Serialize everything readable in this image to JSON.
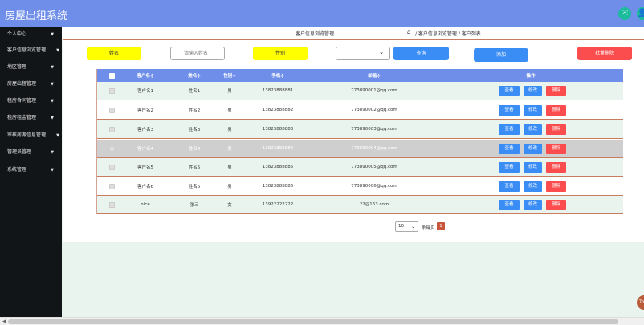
{
  "app": {
    "title": "房屋出租系统"
  },
  "top_icons": [
    {
      "icon": "expand-icon",
      "glyph": "⤧"
    },
    {
      "icon": "user-icon",
      "glyph": "👤"
    }
  ],
  "sidebar": {
    "items": [
      {
        "label": "个人中心"
      },
      {
        "label": "客户信息浏览管理"
      },
      {
        "label": "地区管理"
      },
      {
        "label": "房屋出租管理"
      },
      {
        "label": "租房合同管理"
      },
      {
        "label": "租房租金管理"
      },
      {
        "label": "审核房源信息管理"
      },
      {
        "label": "管理员管理"
      },
      {
        "label": "系统管理"
      }
    ]
  },
  "breadcrumb": {
    "title": "客户信息浏览管理",
    "path": "/ 客户信息浏览管理 / 客户列表"
  },
  "filters": {
    "name_label": "姓名",
    "name_placeholder": "请输入姓名",
    "gender_label": "性别",
    "gender_value": "",
    "search_label": "查询",
    "add_label": "添加",
    "batch_delete_label": "批量删除"
  },
  "table": {
    "headers": [
      "",
      "客户名≑",
      "姓名≑",
      "性别≑",
      "手机≑",
      "邮箱≑",
      "操作"
    ],
    "action_labels": {
      "view": "查看",
      "edit": "修改",
      "delete": "删除"
    },
    "rows": [
      {
        "customer": "客户名1",
        "name": "姓名1",
        "gender": "男",
        "phone": "13823888881",
        "email": "773890001@qq.com"
      },
      {
        "customer": "客户名2",
        "name": "姓名2",
        "gender": "男",
        "phone": "13823888882",
        "email": "773890002@qq.com"
      },
      {
        "customer": "客户名3",
        "name": "姓名3",
        "gender": "男",
        "phone": "13823888883",
        "email": "773890003@qq.com"
      },
      {
        "customer": "客户名4",
        "name": "姓名4",
        "gender": "男",
        "phone": "13823888884",
        "email": "773890004@qq.com"
      },
      {
        "customer": "客户名5",
        "name": "姓名5",
        "gender": "男",
        "phone": "13823888885",
        "email": "773890005@qq.com"
      },
      {
        "customer": "客户名6",
        "name": "姓名6",
        "gender": "男",
        "phone": "13823888886",
        "email": "773890006@qq.com"
      },
      {
        "customer": "nice",
        "name": "张三",
        "gender": "女",
        "phone": "13922222222",
        "email": "22@163.com"
      }
    ]
  },
  "pagination": {
    "page_size": "10",
    "page_size_label": "条每页",
    "current_page": "1"
  },
  "float_button": {
    "label": "To"
  },
  "colors": {
    "topbar": "#6e8ee9",
    "sidebar": "#121518",
    "primary": "#3b8df6",
    "danger": "#fb4d4d",
    "highlight": "#ffff00"
  }
}
